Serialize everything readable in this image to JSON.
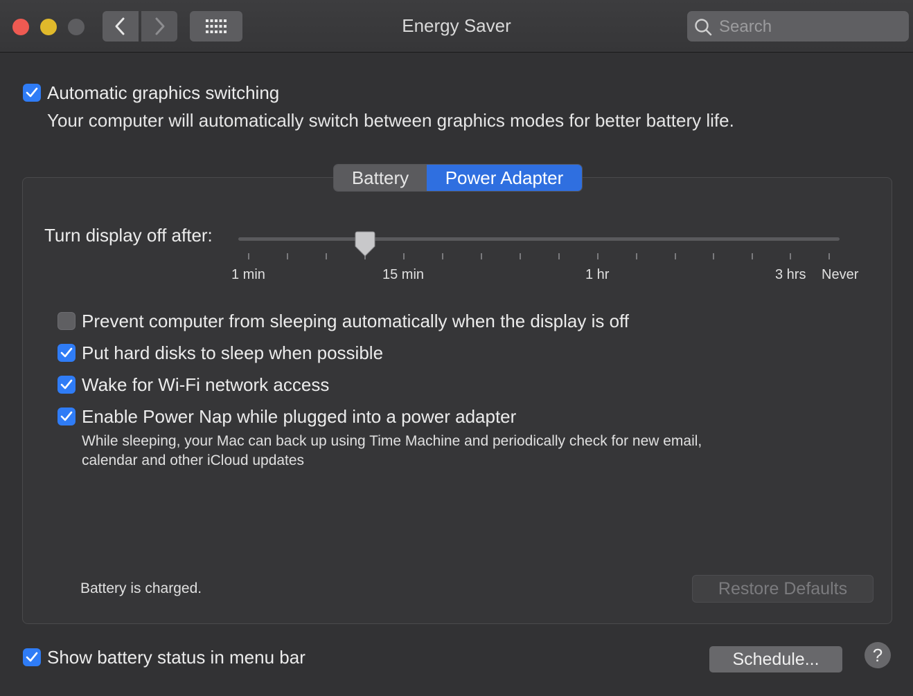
{
  "window": {
    "title": "Energy Saver",
    "search_placeholder": "Search"
  },
  "auto_graphics": {
    "label": "Automatic graphics switching",
    "checked": true,
    "description": "Your computer will automatically switch between graphics modes for better battery life."
  },
  "tabs": [
    {
      "label": "Battery",
      "selected": false
    },
    {
      "label": "Power Adapter",
      "selected": true
    }
  ],
  "display_off": {
    "label": "Turn display off after:",
    "value": "10 min",
    "tick_labels": [
      "1 min",
      "15 min",
      "1 hr",
      "3 hrs",
      "Never"
    ]
  },
  "options": [
    {
      "label": "Prevent computer from sleeping automatically when the display is off",
      "checked": false
    },
    {
      "label": "Put hard disks to sleep when possible",
      "checked": true
    },
    {
      "label": "Wake for Wi-Fi network access",
      "checked": true
    },
    {
      "label": "Enable Power Nap while plugged into a power adapter",
      "checked": true
    }
  ],
  "power_nap_description": {
    "line1": "While sleeping, your Mac can back up using Time Machine and periodically check for new email,",
    "line2": "calendar and other iCloud updates"
  },
  "battery_status": "Battery is charged.",
  "restore_defaults": "Restore Defaults",
  "show_battery": {
    "label": "Show battery status in menu bar",
    "checked": true
  },
  "schedule_button": "Schedule...",
  "help_button": "?",
  "colors": {
    "accent": "#2f7cf6",
    "background": "#323234"
  }
}
